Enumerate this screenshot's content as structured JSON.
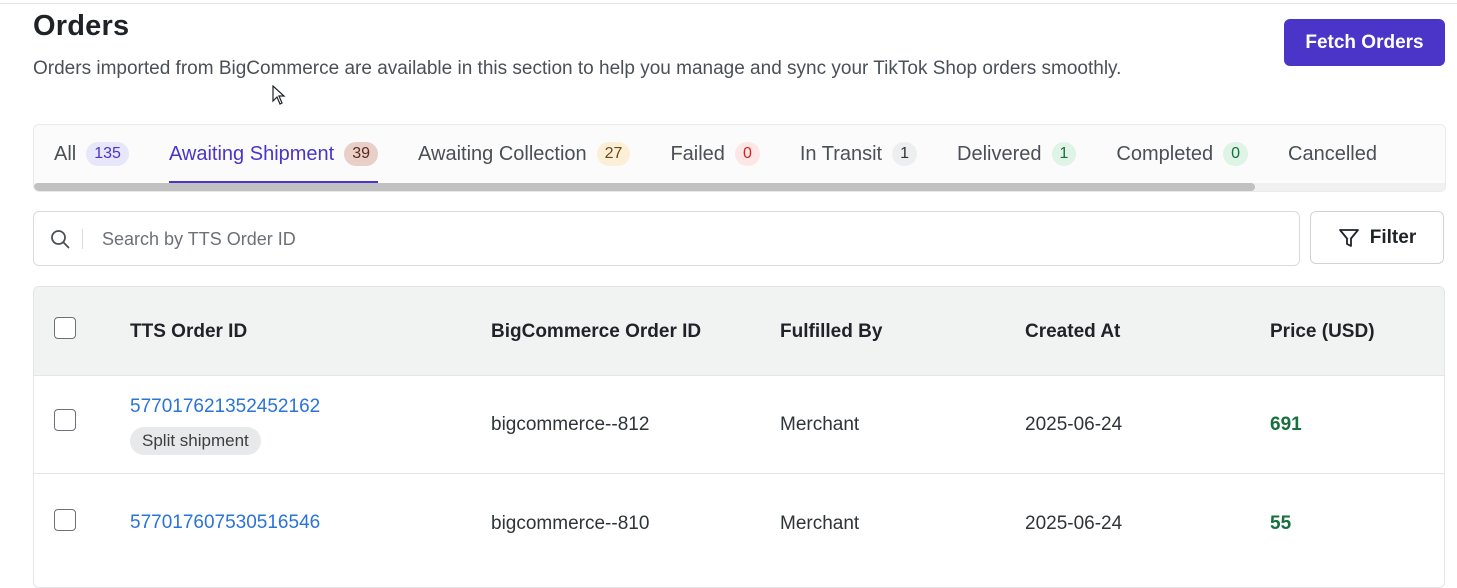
{
  "header": {
    "title": "Orders",
    "subtitle": "Orders imported from BigCommerce are available in this section to help you manage and sync your TikTok Shop orders smoothly.",
    "fetch_label": "Fetch Orders"
  },
  "tabs": [
    {
      "label": "All",
      "count": "135"
    },
    {
      "label": "Awaiting Shipment",
      "count": "39"
    },
    {
      "label": "Awaiting Collection",
      "count": "27"
    },
    {
      "label": "Failed",
      "count": "0"
    },
    {
      "label": "In Transit",
      "count": "1"
    },
    {
      "label": "Delivered",
      "count": "1"
    },
    {
      "label": "Completed",
      "count": "0"
    },
    {
      "label": "Cancelled",
      "count": ""
    }
  ],
  "search": {
    "placeholder": "Search by TTS Order ID",
    "value": ""
  },
  "filter_label": "Filter",
  "table": {
    "columns": [
      "TTS Order ID",
      "BigCommerce Order ID",
      "Fulfilled By",
      "Created At",
      "Price (USD)"
    ],
    "rows": [
      {
        "tts_order_id": "577017621352452162",
        "tag": "Split shipment",
        "bc_order_id": "bigcommerce--812",
        "fulfilled_by": "Merchant",
        "created_at": "2025-06-24",
        "price": "691"
      },
      {
        "tts_order_id": "577017607530516546",
        "tag": "",
        "bc_order_id": "bigcommerce--810",
        "fulfilled_by": "Merchant",
        "created_at": "2025-06-24",
        "price": "55"
      }
    ]
  },
  "colors": {
    "accent": "#4a35c8",
    "link": "#2a73d8",
    "price": "#17703e"
  }
}
